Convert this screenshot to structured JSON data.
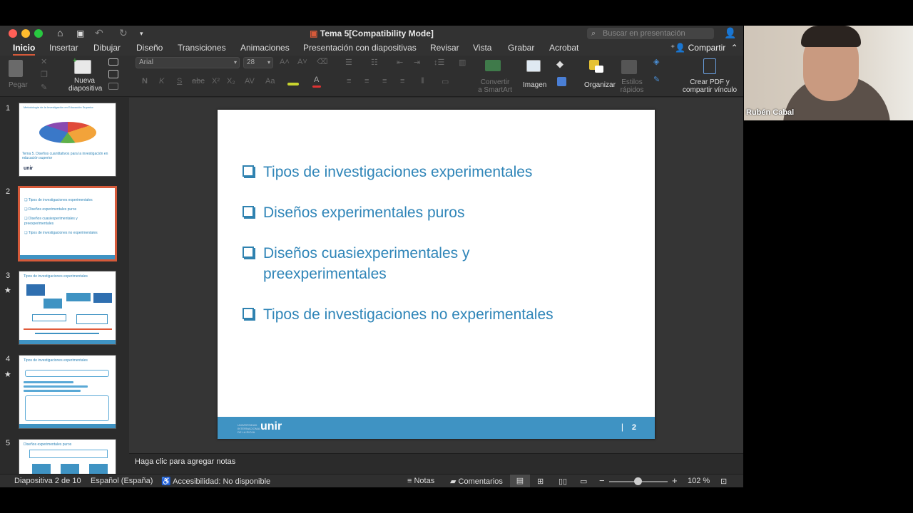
{
  "window": {
    "title": "Tema 5[Compatibility Mode]",
    "search_placeholder": "Buscar en presentación"
  },
  "ribbon": {
    "tabs": [
      "Inicio",
      "Insertar",
      "Dibujar",
      "Diseño",
      "Transiciones",
      "Animaciones",
      "Presentación con diapositivas",
      "Revisar",
      "Vista",
      "Grabar",
      "Acrobat"
    ],
    "active_tab": "Inicio",
    "share_label": "Compartir"
  },
  "toolbar": {
    "paste_label": "Pegar",
    "new_slide_label_1": "Nueva",
    "new_slide_label_2": "diapositiva",
    "font_name": "Arial",
    "font_size": "28",
    "convert_smartart_1": "Convertir",
    "convert_smartart_2": "a SmartArt",
    "image_label": "Imagen",
    "arrange_label": "Organizar",
    "quick_styles_1": "Estilos",
    "quick_styles_2": "rápidos",
    "create_pdf_1": "Crear PDF y",
    "create_pdf_2": "compartir vínculo"
  },
  "thumbnails": [
    {
      "number": "1",
      "title": "Metodología de la Investigación en Educación Superior",
      "heading": "Tema 5. Diseños cuantitativos para la investigación en educación superior",
      "logo": "unir"
    },
    {
      "number": "2",
      "lines": [
        "Tipos de investigaciones experimentales",
        "Diseños experimentales puros",
        "Diseños cuasiexperimentales y preexperimentales",
        "Tipos de investigaciones no experimentales"
      ]
    },
    {
      "number": "3",
      "title": "Tipos de investigaciones experimentales",
      "star": "★"
    },
    {
      "number": "4",
      "title": "Tipos de investigaciones experimentales",
      "star": "★"
    },
    {
      "number": "5",
      "title": "Diseños experimentales puros"
    }
  ],
  "slide": {
    "bullets": [
      "Tipos de investigaciones experimentales",
      "Diseños experimentales puros",
      "Diseños cuasiexperimentales y preexperimentales",
      "Tipos de investigaciones no experimentales"
    ],
    "footer_logo": "unir",
    "footer_small": "UNIVERSIDAD INTERNACIONAL DE LA RIOJA",
    "page_number": "2"
  },
  "notes_placeholder": "Haga clic para agregar notas",
  "status": {
    "slide_info": "Diapositiva 2 de 10",
    "language": "Español (España)",
    "accessibility": "Accesibilidad: No disponible",
    "notes": "Notas",
    "comments": "Comentarios",
    "zoom": "102 %"
  },
  "video": {
    "participant_name": "Rubén Cabal"
  },
  "colors": {
    "accent": "#d65a3a",
    "slide_blue": "#3f93c3",
    "text_blue": "#2f85b8"
  }
}
